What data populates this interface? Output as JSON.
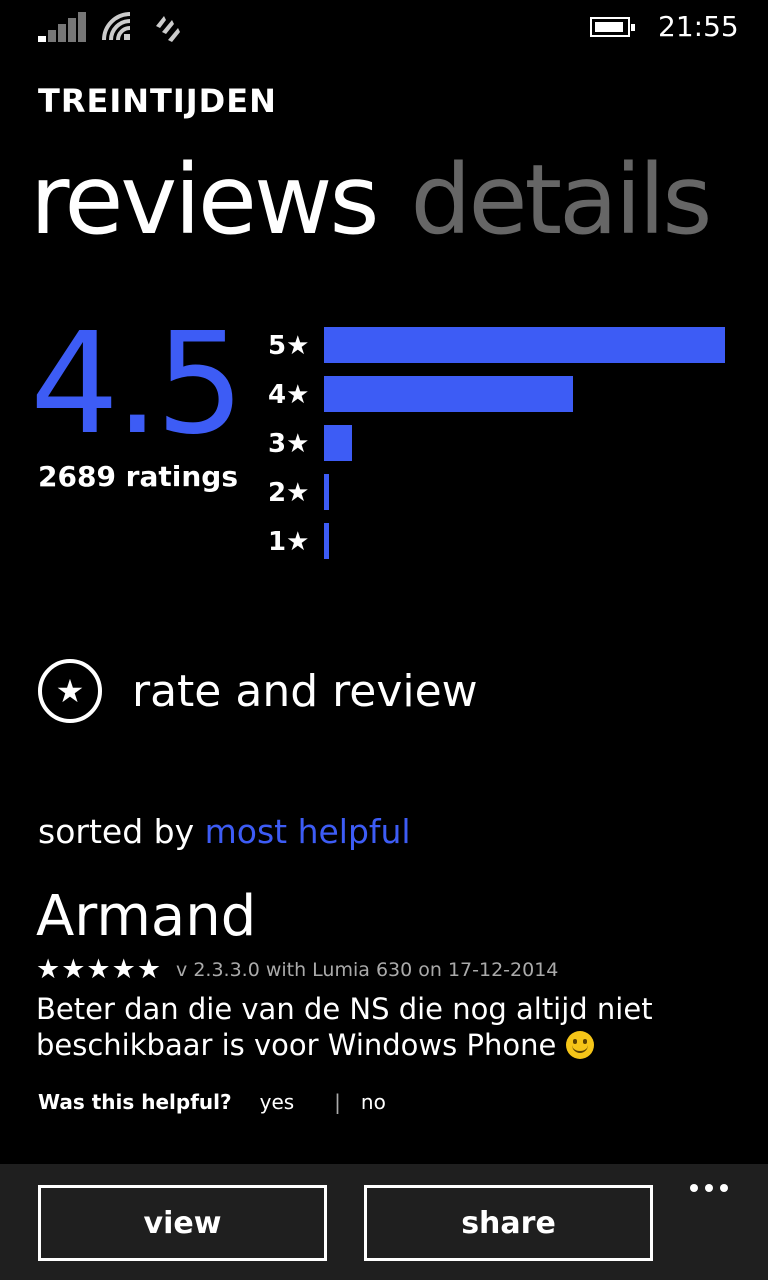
{
  "status_bar": {
    "time": "21:55",
    "icons": [
      "signal-icon",
      "wifi-icon",
      "data-icon",
      "battery-icon"
    ]
  },
  "app_title": "TREINTIJDEN",
  "pivot": {
    "tabs": [
      {
        "label": "reviews",
        "active": true
      },
      {
        "label": "details",
        "active": false
      }
    ]
  },
  "rating": {
    "average": "4.5",
    "count_label": "2689 ratings",
    "distribution": [
      {
        "label": "5★",
        "fraction": 1.0
      },
      {
        "label": "4★",
        "fraction": 0.62
      },
      {
        "label": "3★",
        "fraction": 0.07
      },
      {
        "label": "2★",
        "fraction": 0.013
      },
      {
        "label": "1★",
        "fraction": 0.013
      }
    ]
  },
  "rate_and_review": {
    "icon": "star-circle-icon",
    "label": "rate and review"
  },
  "sort": {
    "prefix": "sorted by ",
    "value": "most helpful"
  },
  "review": {
    "author": "Armand",
    "stars": "★★★★★",
    "star_count": 5,
    "meta": "v 2.3.3.0 with Lumia 630 on 17-12-2014",
    "text": "Beter dan die van de NS die nog altijd niet beschikbaar is voor Windows Phone ",
    "emoji": "smiley-icon",
    "helpful_question": "Was this helpful?",
    "yes_label": "yes",
    "separator": "|",
    "no_label": "no"
  },
  "app_bar": {
    "view_label": "view",
    "share_label": "share",
    "more_icon": "ellipsis-icon"
  },
  "colors": {
    "accent": "#3d5cf5",
    "background": "#000000",
    "inactive_tab": "#666666",
    "app_bar": "#1f1f1f"
  }
}
